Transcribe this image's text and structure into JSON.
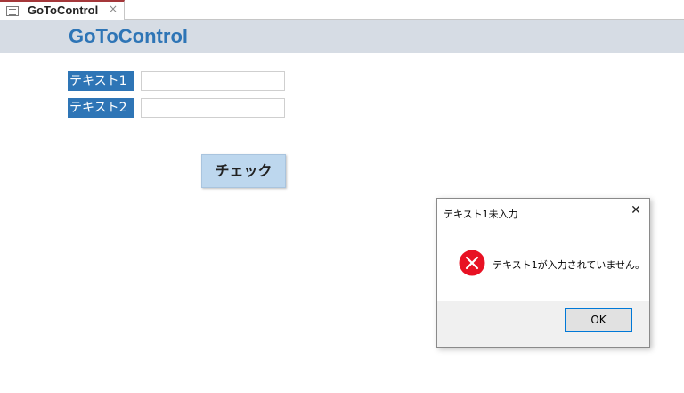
{
  "tab": {
    "icon": "form-icon",
    "title": "GoToControl",
    "close_glyph": "×"
  },
  "form": {
    "title": "GoToControl",
    "fields": [
      {
        "label": "テキスト1",
        "value": ""
      },
      {
        "label": "テキスト2",
        "value": ""
      }
    ],
    "check_button_label": "チェック"
  },
  "dialog": {
    "title": "テキスト1未入力",
    "close_glyph": "✕",
    "icon": "error-icon",
    "message": "テキスト1が入力されていません。",
    "ok_label": "OK"
  },
  "colors": {
    "accent": "#2e75b6",
    "header_bg": "#d6dce4",
    "button_bg": "#bdd7ee",
    "error_red": "#e81123"
  }
}
